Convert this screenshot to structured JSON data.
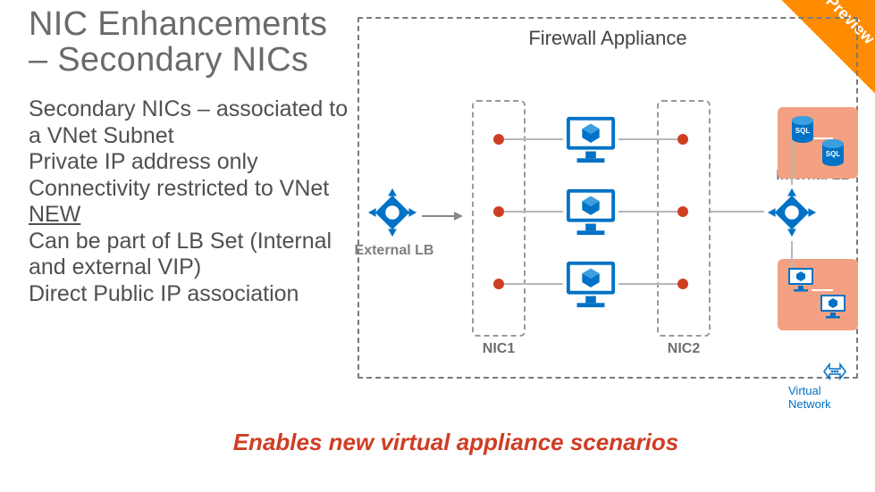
{
  "title_line1": "NIC Enhancements",
  "title_line2": "– Secondary NICs",
  "bullets": {
    "b1": "Secondary NICs – associated to a VNet Subnet",
    "b2": "Private IP address only",
    "b3": "Connectivity restricted to VNet",
    "new": "NEW",
    "b4": "Can be part of LB Set (Internal and external VIP)",
    "b5": "Direct Public IP association"
  },
  "diagram": {
    "firewall": "Firewall Appliance",
    "external_lb": "External LB",
    "internal_lb": "Internal LB",
    "nic1": "NIC1",
    "nic2": "NIC2",
    "sql": "SQL",
    "vnet": "Virtual Network"
  },
  "tagline": "Enables new virtual appliance scenarios",
  "preview": "Preview",
  "colors": {
    "azure_blue": "#0072c6",
    "accent_orange": "#ff8c00",
    "red": "#cf3e24",
    "peach": "#f3a182",
    "gray_text": "#6a6a6a"
  }
}
